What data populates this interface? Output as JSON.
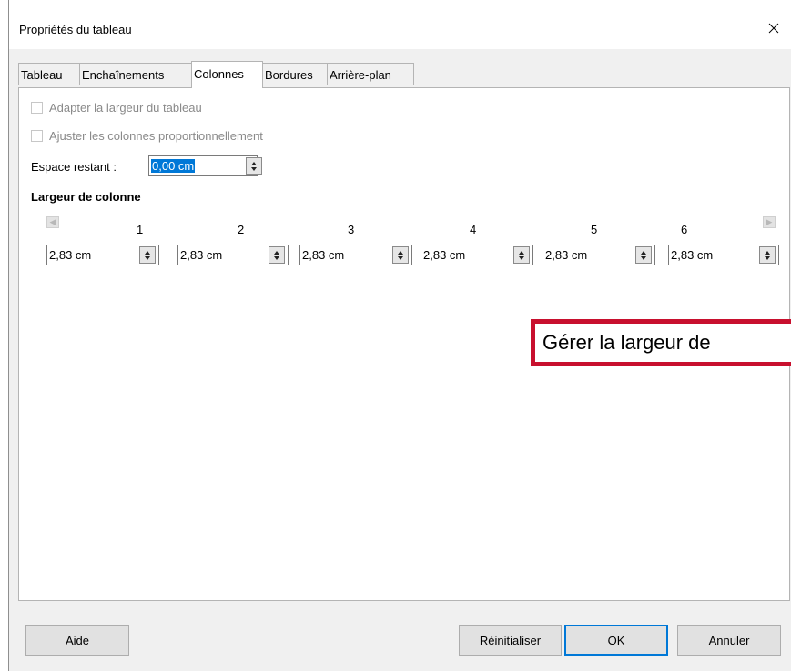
{
  "dialog": {
    "title": "Propriétés du tableau",
    "close_glyph": "✕"
  },
  "tabs": [
    {
      "label": "Tableau",
      "active": false
    },
    {
      "label": "Enchaînements",
      "active": false
    },
    {
      "label": "Colonnes",
      "active": true
    },
    {
      "label": "Bordures",
      "active": false
    },
    {
      "label": "Arrière-plan",
      "active": false
    }
  ],
  "options": {
    "adapt_width": {
      "label": "Adapter la largeur du tableau",
      "checked": false,
      "enabled": false
    },
    "adjust_proportional": {
      "label": "Ajuster les colonnes proportionnellement",
      "checked": false,
      "enabled": false
    }
  },
  "remaining_space": {
    "label": "Espace restant :",
    "value": "0,00 cm"
  },
  "column_width": {
    "heading": "Largeur de colonne",
    "columns": [
      {
        "number": "1",
        "value": "2,83 cm"
      },
      {
        "number": "2",
        "value": "2,83 cm"
      },
      {
        "number": "3",
        "value": "2,83 cm"
      },
      {
        "number": "4",
        "value": "2,83 cm"
      },
      {
        "number": "5",
        "value": "2,83 cm"
      },
      {
        "number": "6",
        "value": "2,83 cm"
      }
    ]
  },
  "callout": {
    "text": "Gérer la largeur de"
  },
  "buttons": {
    "help": "Aide",
    "reset": "Réinitialiser",
    "ok": "OK",
    "cancel": "Annuler"
  },
  "colors": {
    "accent": "#0078d7",
    "callout_border": "#c8102e"
  }
}
